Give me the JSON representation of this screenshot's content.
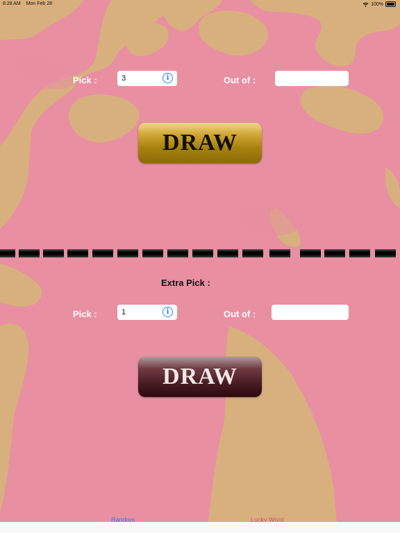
{
  "status_bar": {
    "time": "8:28 AM",
    "date": "Mon Feb 28",
    "battery": "100%"
  },
  "main_draw": {
    "pick_label": "Pick :",
    "pick_value": "3",
    "out_of_label": "Out of :",
    "out_of_value": "",
    "draw_label": "DRAW"
  },
  "extra_draw": {
    "title": "Extra Pick :",
    "pick_label": "Pick :",
    "pick_value": "1",
    "out_of_label": "Out of :",
    "out_of_value": "",
    "draw_label": "DRAW"
  },
  "tab_bar": {
    "tabs": [
      {
        "label": "Random"
      },
      {
        "label": "Lucky Word"
      }
    ]
  },
  "colors": {
    "background_pink": "#e88fa0",
    "camouflage_tan": "#d9b27f",
    "info_blue": "#2f7bf0",
    "gold_button": "#a98310",
    "dark_button": "#4b1c24",
    "tab_active": "#2f7bf0",
    "tab_inactive": "#c4577a"
  },
  "icons": {
    "info": "info-circle-icon",
    "wifi": "wifi-icon",
    "battery": "battery-icon"
  }
}
